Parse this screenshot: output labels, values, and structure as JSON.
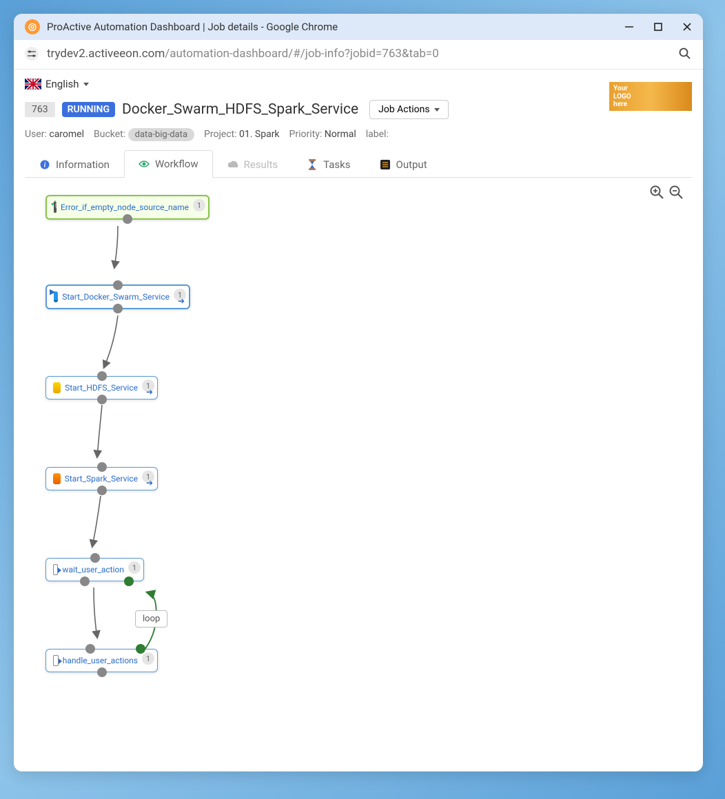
{
  "window": {
    "title": "ProActive Automation Dashboard | Job details - Google Chrome",
    "url_host": "trydev2.activeeon.com",
    "url_path": "/automation-dashboard/#/job-info?jobid=763&tab=0"
  },
  "language": {
    "label": "English"
  },
  "logo": {
    "line1": "Your",
    "line2": "LOGO",
    "line3": "here"
  },
  "job": {
    "id": "763",
    "status": "RUNNING",
    "title": "Docker_Swarm_HDFS_Spark_Service",
    "actions_label": "Job Actions"
  },
  "meta": {
    "user_label": "User:",
    "user": "caromel",
    "bucket_label": "Bucket:",
    "bucket": "data-big-data",
    "project_label": "Project:",
    "project": "01. Spark",
    "priority_label": "Priority:",
    "priority": "Normal",
    "label_label": "label:"
  },
  "tabs": {
    "information": "Information",
    "workflow": "Workflow",
    "results": "Results",
    "tasks": "Tasks",
    "output": "Output"
  },
  "loop_label": "loop",
  "nodes": {
    "n1": {
      "label": "Error_if_empty_node_source_name",
      "num": "1"
    },
    "n2": {
      "label": "Start_Docker_Swarm_Service",
      "num": "1"
    },
    "n3": {
      "label": "Start_HDFS_Service",
      "num": "1"
    },
    "n4": {
      "label": "Start_Spark_Service",
      "num": "1"
    },
    "n5": {
      "label": "wait_user_action",
      "num": "1"
    },
    "n6": {
      "label": "handle_user_actions",
      "num": "1"
    }
  }
}
